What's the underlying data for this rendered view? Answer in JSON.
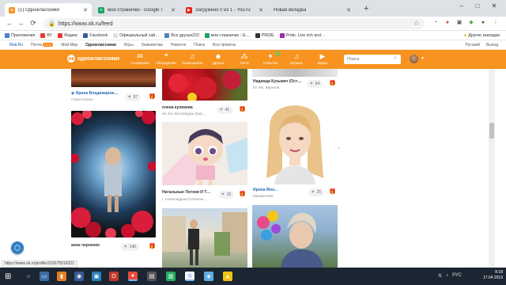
{
  "browser": {
    "tabs": [
      {
        "title": "(1) Одноклассники",
        "color": "#f7931e",
        "icon_text": "ok",
        "active": true
      },
      {
        "title": "мои странички - Google Табл…",
        "color": "#1fa463",
        "icon_text": "+",
        "active": false
      },
      {
        "title": "Загружено 0 из 1 - YouTube",
        "color": "#e62117",
        "icon_text": "▶",
        "active": false
      },
      {
        "title": "Новая вкладка",
        "color": "#ffffff",
        "icon_text": "",
        "active": false
      }
    ],
    "new_tab": "+",
    "window": {
      "minimize": "–",
      "maximize": "□",
      "close": "✕"
    },
    "url": "https://www.ok.ru/feed",
    "bookmarks": [
      {
        "label": "Приложения",
        "color": "#4a7fd4"
      },
      {
        "label": "ВУ",
        "color": "#e53935"
      },
      {
        "label": "Яндекс",
        "color": "#e53935"
      },
      {
        "label": "Facebook",
        "color": "#3b5998"
      },
      {
        "label": "Официальный сай…",
        "color": "#f5f5f5"
      },
      {
        "label": "Все друзья223",
        "color": "#5181b8"
      },
      {
        "label": "мои странички - G…",
        "color": "#1fa463"
      },
      {
        "label": "PRIDE",
        "color": "#333333"
      },
      {
        "label": "Pride. Live rich and…",
        "color": "#9c27b0"
      }
    ],
    "bookmarks_right": "Другие закладки"
  },
  "portal": {
    "items": [
      "Mail.Ru",
      "Почта",
      "Мой Мир",
      "Одноклассники",
      "Игры",
      "Знакомства",
      "Новости",
      "Поиск",
      "Все проекты"
    ],
    "badge": "NEW",
    "right": [
      "Русский",
      "Выход"
    ]
  },
  "ok": {
    "logo": "одноклассники",
    "nav": [
      {
        "label": "Сообщения",
        "icon": "✉"
      },
      {
        "label": "Обсуждения",
        "icon": "💬"
      },
      {
        "label": "Оповещения",
        "icon": "🔔"
      },
      {
        "label": "Друзья",
        "icon": "👥"
      },
      {
        "label": "Гости",
        "icon": "👣"
      },
      {
        "label": "События",
        "icon": "⚡",
        "count": "17"
      },
      {
        "label": "Музыка",
        "icon": "♫"
      },
      {
        "label": "Видео",
        "icon": "▶"
      }
    ],
    "search_placeholder": "Поиск"
  },
  "feed": {
    "cards": [
      {
        "name": "Ирина Владимиров…",
        "meta": "Севастополь",
        "likes": "57"
      },
      {
        "name": "анна черненко",
        "meta": "",
        "likes": "140"
      },
      {
        "name": "елена куликова",
        "meta": "46 лет, Кисловодск (Кав…",
        "likes": "41"
      },
      {
        "name": "Натальные Потоки И Т…",
        "meta": "г. Александров (Алексан…",
        "likes": "15"
      },
      {
        "name": "Надежда Кузьмич (Ост…",
        "meta": "57 лет, Березов",
        "likes": "64"
      },
      {
        "name": "Ирина Моо…",
        "meta": "Мехменгейт",
        "likes": "25"
      }
    ]
  },
  "status_url": "https://www.ok.ru/profile/101675516321",
  "taskbar": {
    "apps": [
      "🗂",
      "⌕",
      "🌐",
      "📁",
      "◉",
      "▣",
      "📥",
      "🖥",
      "📧",
      "⚙"
    ],
    "lang": "РУС",
    "time": "8:18",
    "date": "17.04.2019"
  }
}
